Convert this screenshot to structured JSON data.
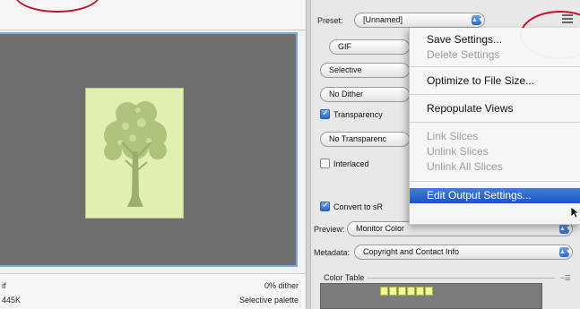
{
  "preview": {
    "status_format": "if",
    "status_size": "445K",
    "status_dither": "0% dither",
    "status_palette": "Selective palette"
  },
  "settings": {
    "preset_label": "Preset:",
    "preset_value": "[Unnamed]",
    "format_value": "GIF",
    "reduction_value": "Selective",
    "dither_value": "No Dither",
    "transparency_label": "Transparency",
    "transparency_checked": true,
    "matte_value": "No Transparenc",
    "interlaced_label": "Interlaced",
    "interlaced_checked": false,
    "convert_label": "Convert to sR",
    "convert_checked": true,
    "preview_label": "Preview:",
    "preview_value": "Monitor Color",
    "metadata_label": "Metadata:",
    "metadata_value": "Copyright and Contact Info",
    "color_table_label": "Color Table",
    "swatch_color": "#f2f990"
  },
  "menu": {
    "save_settings": "Save Settings...",
    "delete_settings": "Delete Settings",
    "optimize": "Optimize to File Size...",
    "repopulate": "Repopulate Views",
    "link_slices": "Link Slices",
    "unlink_slices": "Unlink Slices",
    "unlink_all_slices": "Unlink All Slices",
    "edit_output": "Edit Output Settings..."
  },
  "colors": {
    "accent": "#2c68c9",
    "annotation": "#c8102e",
    "preview_bg": "#6f6f6f",
    "image_bg": "#dff0b0",
    "tree": "#a9bf78"
  }
}
